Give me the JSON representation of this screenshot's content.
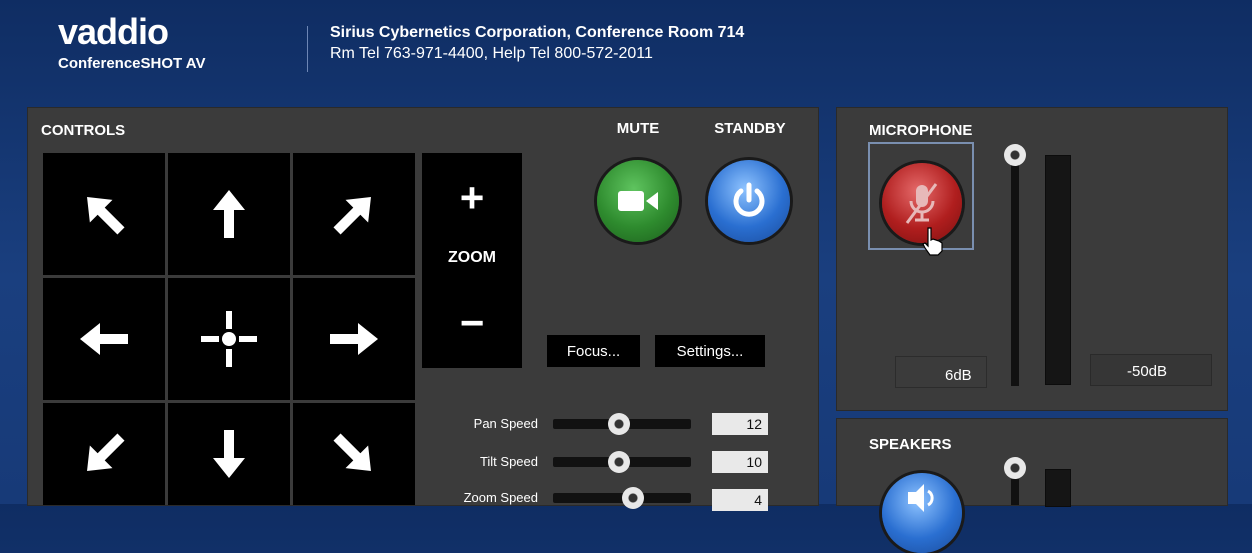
{
  "header": {
    "logo_text": "vaddio",
    "product": "ConferenceSHOT AV",
    "line1": "Sirius Cybernetics Corporation, Conference Room 714",
    "line2": "Rm Tel 763-971-4400, Help Tel 800-572-2011"
  },
  "controls": {
    "title": "CONTROLS",
    "zoom_label": "ZOOM",
    "zoom_in_symbol": "+",
    "zoom_out_symbol": "−",
    "mute_label": "MUTE",
    "standby_label": "STANDBY",
    "focus_button": "Focus...",
    "settings_button": "Settings...",
    "sliders": [
      {
        "label": "Pan Speed",
        "value": "12",
        "fraction": 0.48
      },
      {
        "label": "Tilt Speed",
        "value": "10",
        "fraction": 0.48
      },
      {
        "label": "Zoom Speed",
        "value": "4",
        "fraction": 0.58
      }
    ],
    "colors": {
      "mute": "#2e8b2e",
      "standby": "#2a6fd1"
    }
  },
  "microphone": {
    "title": "MICROPHONE",
    "gain_value": "6dB",
    "meter_value": "-50dB",
    "mute_color": "#b01e1e"
  },
  "speakers": {
    "title": "SPEAKERS",
    "color": "#2a6fd1"
  }
}
